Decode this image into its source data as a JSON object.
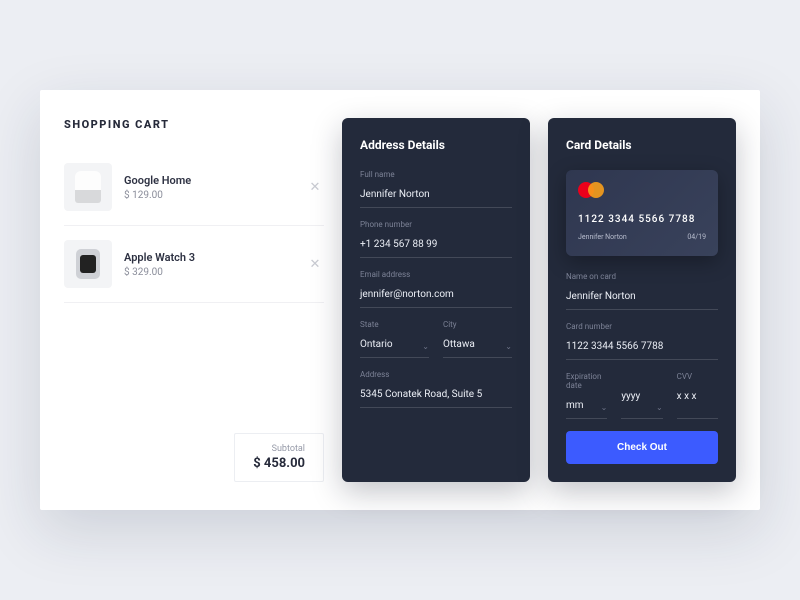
{
  "cart": {
    "title": "SHOPPING CART",
    "items": [
      {
        "name": "Google Home",
        "price": "$ 129.00"
      },
      {
        "name": "Apple Watch 3",
        "price": "$ 329.00"
      }
    ],
    "subtotal_label": "Subtotal",
    "subtotal_value": "$ 458.00"
  },
  "address": {
    "title": "Address Details",
    "full_name_label": "Full name",
    "full_name": "Jennifer Norton",
    "phone_label": "Phone number",
    "phone": "+1  234  567  88  99",
    "email_label": "Email address",
    "email": "jennifer@norton.com",
    "state_label": "State",
    "state": "Ontario",
    "city_label": "City",
    "city": "Ottawa",
    "address_label": "Address",
    "address_line": "5345 Conatek Road, Suite 5"
  },
  "card": {
    "title": "Card Details",
    "cc_number_display": "1122  3344  5566  7788",
    "cc_holder": "Jennifer Norton",
    "cc_exp": "04/19",
    "name_label": "Name on card",
    "name_value": "Jennifer Norton",
    "number_label": "Card number",
    "number_value": "1122  3344  5566  7788",
    "exp_label": "Expiration date",
    "exp_mm": "mm",
    "exp_yyyy": "yyyy",
    "cvv_label": "CVV",
    "cvv_value": "x x x",
    "checkout_label": "Check Out"
  }
}
